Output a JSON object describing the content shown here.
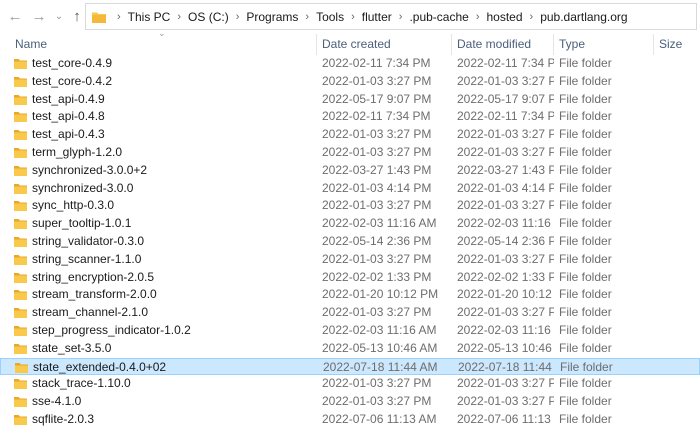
{
  "breadcrumb": [
    "This PC",
    "OS (C:)",
    "Programs",
    "Tools",
    "flutter",
    ".pub-cache",
    "hosted",
    "pub.dartlang.org"
  ],
  "columns": {
    "name": "Name",
    "created": "Date created",
    "modified": "Date modified",
    "type": "Type",
    "size": "Size"
  },
  "rows": [
    {
      "name": "test_core-0.4.9",
      "created": "2022-02-11 7:34 PM",
      "modified": "2022-02-11 7:34 PM",
      "type": "File folder"
    },
    {
      "name": "test_core-0.4.2",
      "created": "2022-01-03 3:27 PM",
      "modified": "2022-01-03 3:27 PM",
      "type": "File folder"
    },
    {
      "name": "test_api-0.4.9",
      "created": "2022-05-17 9:07 PM",
      "modified": "2022-05-17 9:07 PM",
      "type": "File folder"
    },
    {
      "name": "test_api-0.4.8",
      "created": "2022-02-11 7:34 PM",
      "modified": "2022-02-11 7:34 PM",
      "type": "File folder"
    },
    {
      "name": "test_api-0.4.3",
      "created": "2022-01-03 3:27 PM",
      "modified": "2022-01-03 3:27 PM",
      "type": "File folder"
    },
    {
      "name": "term_glyph-1.2.0",
      "created": "2022-01-03 3:27 PM",
      "modified": "2022-01-03 3:27 PM",
      "type": "File folder"
    },
    {
      "name": "synchronized-3.0.0+2",
      "created": "2022-03-27 1:43 PM",
      "modified": "2022-03-27 1:43 PM",
      "type": "File folder"
    },
    {
      "name": "synchronized-3.0.0",
      "created": "2022-01-03 4:14 PM",
      "modified": "2022-01-03 4:14 PM",
      "type": "File folder"
    },
    {
      "name": "sync_http-0.3.0",
      "created": "2022-01-03 3:27 PM",
      "modified": "2022-01-03 3:27 PM",
      "type": "File folder"
    },
    {
      "name": "super_tooltip-1.0.1",
      "created": "2022-02-03 11:16 AM",
      "modified": "2022-02-03 11:16 ...",
      "type": "File folder"
    },
    {
      "name": "string_validator-0.3.0",
      "created": "2022-05-14 2:36 PM",
      "modified": "2022-05-14 2:36 PM",
      "type": "File folder"
    },
    {
      "name": "string_scanner-1.1.0",
      "created": "2022-01-03 3:27 PM",
      "modified": "2022-01-03 3:27 PM",
      "type": "File folder"
    },
    {
      "name": "string_encryption-2.0.5",
      "created": "2022-02-02 1:33 PM",
      "modified": "2022-02-02 1:33 PM",
      "type": "File folder"
    },
    {
      "name": "stream_transform-2.0.0",
      "created": "2022-01-20 10:12 PM",
      "modified": "2022-01-20 10:12 ...",
      "type": "File folder"
    },
    {
      "name": "stream_channel-2.1.0",
      "created": "2022-01-03 3:27 PM",
      "modified": "2022-01-03 3:27 PM",
      "type": "File folder"
    },
    {
      "name": "step_progress_indicator-1.0.2",
      "created": "2022-02-03 11:16 AM",
      "modified": "2022-02-03 11:16 ...",
      "type": "File folder"
    },
    {
      "name": "state_set-3.5.0",
      "created": "2022-05-13 10:46 AM",
      "modified": "2022-05-13 10:46 ...",
      "type": "File folder"
    },
    {
      "name": "state_extended-0.4.0+02",
      "created": "2022-07-18 11:44 AM",
      "modified": "2022-07-18 11:44 ...",
      "type": "File folder",
      "selected": true
    },
    {
      "name": "stack_trace-1.10.0",
      "created": "2022-01-03 3:27 PM",
      "modified": "2022-01-03 3:27 PM",
      "type": "File folder"
    },
    {
      "name": "sse-4.1.0",
      "created": "2022-01-03 3:27 PM",
      "modified": "2022-01-03 3:27 PM",
      "type": "File folder"
    },
    {
      "name": "sqflite-2.0.3",
      "created": "2022-07-06 11:13 AM",
      "modified": "2022-07-06 11:13 ...",
      "type": "File folder"
    }
  ],
  "colors": {
    "folder": "#f8c94a",
    "selected_bg": "#cce8ff",
    "header_text": "#4c607a"
  },
  "icons": {
    "back": "back-arrow-icon",
    "forward": "forward-arrow-icon",
    "recent": "chevron-down-icon",
    "up": "up-arrow-icon",
    "folder": "folder-icon"
  }
}
